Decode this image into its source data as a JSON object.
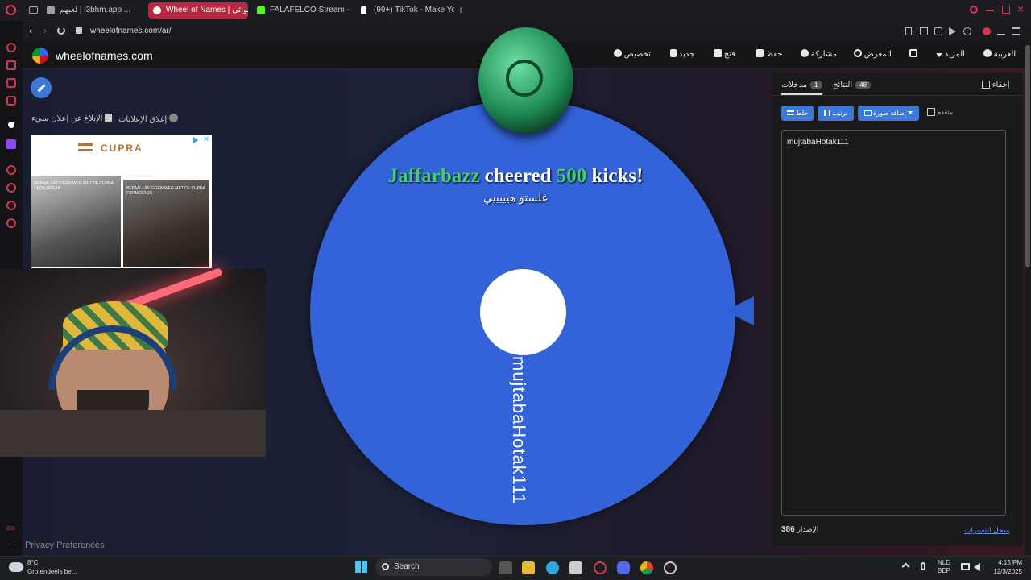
{
  "browser": {
    "tabs": [
      {
        "label": "لعبهم | l3bhm.app ...",
        "color": "#9aa0a6"
      },
      {
        "label": "Wheel of Names | عشوائي",
        "color": "#e23c55"
      },
      {
        "label": "FALAFELCO Stream - Wa",
        "color": "#53fc18"
      },
      {
        "label": "(99+) TikTok - Make Your",
        "color": "#ffffff"
      }
    ],
    "url": "wheelofnames.com/ar/"
  },
  "header": {
    "logo": "wheelofnames.com",
    "nav": [
      {
        "label": "العربية",
        "icon": "globe-icon"
      },
      {
        "label": "المزيد",
        "icon": "caret-down-icon"
      },
      {
        "label": "",
        "icon": "fullscreen-icon"
      },
      {
        "label": "المعرض",
        "icon": "search-icon"
      },
      {
        "label": "مشاركة",
        "icon": "share-icon"
      },
      {
        "label": "حفظ",
        "icon": "save-icon"
      },
      {
        "label": "فتح",
        "icon": "folder-icon"
      },
      {
        "label": "جديد",
        "icon": "file-icon"
      },
      {
        "label": "تخصيص",
        "icon": "palette-icon"
      }
    ]
  },
  "ads": {
    "close_ads": "إغلاق الإعلانات",
    "report_ad": "الإبلاغ عن إعلان سيء",
    "brand": "CUPRA",
    "ad_text_1": "BEPAAL UW EIGEN WEG MET DE CUPRA LEON BREAK",
    "ad_text_2": "BEPAAL UW EIGEN WEG MET DE CUPRA FORMENTOR"
  },
  "wheel": {
    "entry": "mujtabaHotak111",
    "color": "#3463d9"
  },
  "cheer": {
    "user": "Jaffarbazz",
    "word1": "cheered",
    "amount": "500",
    "word2": "kicks!",
    "message": "غلستو هيييييي"
  },
  "panel": {
    "hide_label": "إخفاء",
    "tab_results": "النتائج",
    "tab_results_count": "48",
    "tab_entries": "مدخلات",
    "tab_entries_count": "1",
    "advanced_label": "متقدم",
    "add_image": "إضافة صورة",
    "sort": "ترتيب",
    "shuffle": "خلط",
    "entries_text": "mujtabaHotak111",
    "version_label": "الإصدار",
    "version": "386",
    "changelog": "سجل التغييرات"
  },
  "privacy": "Privacy Preferences",
  "taskbar": {
    "weather_temp": "8°C",
    "weather_desc": "Grotendeels be...",
    "search": "Search",
    "lang1": "NLD",
    "lang2": "BEP",
    "time": "4:15 PM",
    "date": "12/3/2025"
  }
}
